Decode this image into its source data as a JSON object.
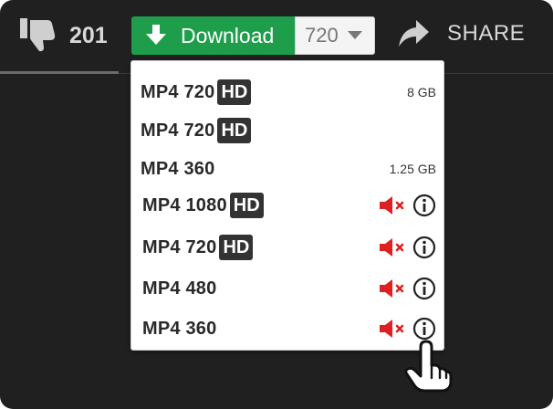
{
  "header": {
    "dislike_count": "201",
    "download_label": "Download",
    "quality_value": "720",
    "share_label": "SHARE"
  },
  "menu": {
    "items": [
      {
        "format": "MP4 720",
        "badge": "HD",
        "size": "8 GB"
      },
      {
        "format": "MP4 720",
        "badge": "HD",
        "size": ""
      },
      {
        "format": "MP4 360",
        "badge": "",
        "size": "1.25 GB"
      },
      {
        "format": "MP4 1080",
        "badge": "HD",
        "size": ""
      },
      {
        "format": "MP4 720",
        "badge": "HD",
        "size": ""
      },
      {
        "format": "MP4 480",
        "badge": "",
        "size": ""
      },
      {
        "format": "MP4 360",
        "badge": "",
        "size": ""
      }
    ]
  },
  "icons": [
    "thumbs-down-icon",
    "download-arrow-icon",
    "chevron-down-icon",
    "share-arrow-icon",
    "muted-speaker-icon",
    "info-icon",
    "hand-pointer-icon"
  ],
  "colors": {
    "background": "#202020",
    "download_green": "#1e9e4b",
    "muted_red": "#e02020",
    "badge": "#333333"
  }
}
